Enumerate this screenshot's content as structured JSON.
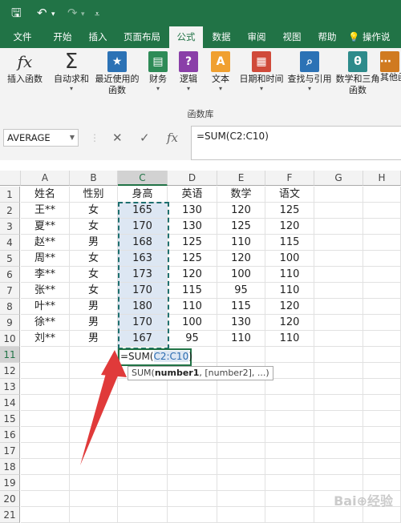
{
  "quick_access": {
    "save_icon": "save-icon",
    "undo_icon": "undo-icon",
    "redo_icon": "redo-icon",
    "customize_icon": "customize-qat-icon"
  },
  "tabs": [
    "文件",
    "开始",
    "插入",
    "页面布局",
    "公式",
    "数据",
    "审阅",
    "视图",
    "帮助",
    "操作说"
  ],
  "active_tab": "公式",
  "ribbon": {
    "buttons": [
      {
        "label": "插入函数",
        "icon": "fx-icon"
      },
      {
        "label": "自动求和",
        "icon": "sigma-icon"
      },
      {
        "label": "最近使用的函数",
        "icon": "star-icon"
      },
      {
        "label": "财务",
        "icon": "finance-icon"
      },
      {
        "label": "逻辑",
        "icon": "logic-icon"
      },
      {
        "label": "文本",
        "icon": "text-icon"
      },
      {
        "label": "日期和时间",
        "icon": "calendar-icon"
      },
      {
        "label": "查找与引用",
        "icon": "lookup-icon"
      },
      {
        "label": "数学和三角函数",
        "icon": "math-icon"
      },
      {
        "label": "其他函",
        "icon": "more-functions-icon"
      }
    ],
    "group_label": "函数库"
  },
  "formula_bar": {
    "name_box": "AVERAGE",
    "cancel": "✕",
    "enter": "✓",
    "fx": "fx",
    "formula": "=SUM(C2:C10)"
  },
  "columns": [
    "A",
    "B",
    "C",
    "D",
    "E",
    "F",
    "G",
    "H"
  ],
  "rows": [
    "1",
    "2",
    "3",
    "4",
    "5",
    "6",
    "7",
    "8",
    "9",
    "10",
    "11",
    "12",
    "13",
    "14",
    "15",
    "16",
    "17",
    "18",
    "19",
    "20",
    "21"
  ],
  "headers": [
    "姓名",
    "性别",
    "身高",
    "英语",
    "数学",
    "语文"
  ],
  "data_rows": [
    [
      "王**",
      "女",
      "165",
      "130",
      "120",
      "125"
    ],
    [
      "夏**",
      "女",
      "170",
      "130",
      "125",
      "120"
    ],
    [
      "赵**",
      "男",
      "168",
      "125",
      "110",
      "115"
    ],
    [
      "周**",
      "女",
      "163",
      "125",
      "120",
      "100"
    ],
    [
      "李**",
      "女",
      "173",
      "120",
      "100",
      "110"
    ],
    [
      "张**",
      "女",
      "170",
      "115",
      "95",
      "110"
    ],
    [
      "叶**",
      "男",
      "180",
      "110",
      "115",
      "120"
    ],
    [
      "徐**",
      "男",
      "170",
      "100",
      "130",
      "120"
    ],
    [
      "刘**",
      "男",
      "167",
      "95",
      "110",
      "110"
    ]
  ],
  "edit_cell": {
    "prefix": "=SUM(",
    "ref": "C2:C10",
    "suffix": ")"
  },
  "tooltip": {
    "fn": "SUM(",
    "arg1": "number1",
    "rest": ", [number2], ...)"
  },
  "colors": {
    "excel_green": "#217346",
    "range_fill": "#dde7f3",
    "arrow": "#e03a3a"
  }
}
